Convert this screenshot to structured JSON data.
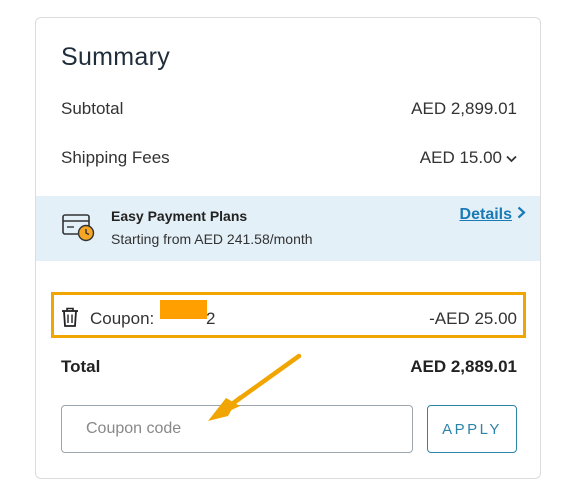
{
  "summary": {
    "title": "Summary",
    "subtotal_label": "Subtotal",
    "subtotal_value": "AED 2,899.01",
    "shipping_label": "Shipping Fees",
    "shipping_value": "AED 15.00"
  },
  "payment_plans": {
    "title": "Easy Payment Plans",
    "subtitle": "Starting from AED 241.58/month",
    "link_label": "Details",
    "icon": "card-clock-icon"
  },
  "coupon": {
    "label": "Coupon: ",
    "code_visible": "2",
    "amount": "-AED 25.00",
    "icon": "trash-icon"
  },
  "total": {
    "label": "Total",
    "value": "AED 2,889.01"
  },
  "coupon_form": {
    "placeholder": "Coupon code",
    "value": "",
    "apply_label": "APPLY"
  },
  "colors": {
    "highlight": "#f0a500",
    "redaction": "#ff9f00",
    "link": "#1a7ab5",
    "plans_bg": "#e4f0f8",
    "apply_border": "#2d84a9"
  }
}
